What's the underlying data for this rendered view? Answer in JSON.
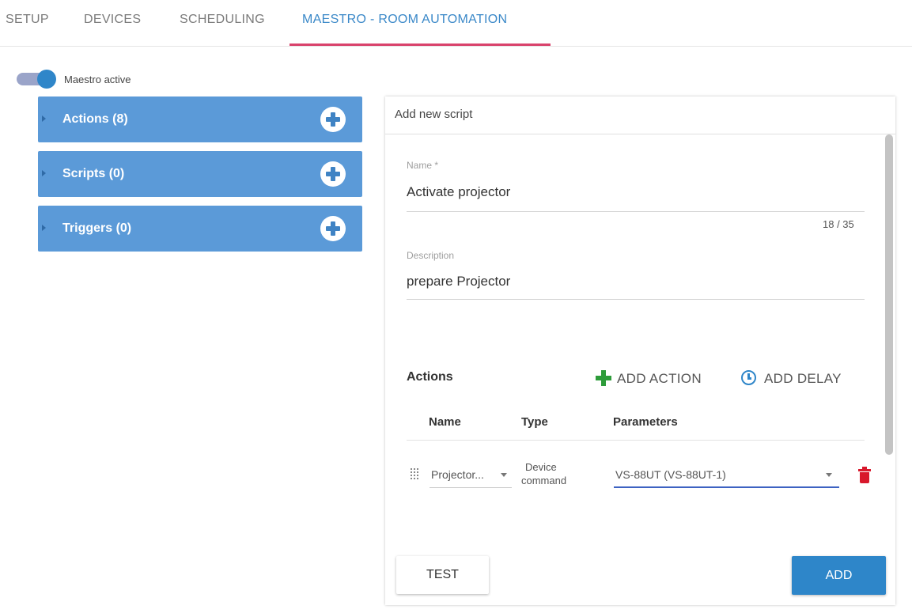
{
  "tabs": [
    {
      "label": "SETUP"
    },
    {
      "label": "DEVICES"
    },
    {
      "label": "SCHEDULING"
    },
    {
      "label": "MAESTRO - ROOM AUTOMATION",
      "active": true
    }
  ],
  "toggle": {
    "label": "Maestro active",
    "on": true
  },
  "panels": [
    {
      "label": "Actions (8)"
    },
    {
      "label": "Scripts (0)"
    },
    {
      "label": "Triggers (0)"
    }
  ],
  "form": {
    "title": "Add new script",
    "name_label": "Name *",
    "name_value": "Activate projector",
    "name_counter": "18 / 35",
    "description_label": "Description",
    "description_value": "prepare Projector",
    "actions_title": "Actions",
    "add_action_label": "ADD ACTION",
    "add_delay_label": "ADD DELAY",
    "columns": {
      "name": "Name",
      "type": "Type",
      "parameters": "Parameters"
    },
    "rows": [
      {
        "name": "Projector...",
        "type_line1": "Device",
        "type_line2": "command",
        "parameter": "VS-88UT (VS-88UT-1)"
      }
    ],
    "test_label": "TEST",
    "add_label": "ADD"
  },
  "colors": {
    "accent": "#2e86c9",
    "panel": "#5b9ad8",
    "tab_active": "#3a88c8",
    "tab_underline": "#d9436c",
    "add_action": "#2e9c3a",
    "delete": "#d8182c"
  },
  "icons": [
    "plus-circle-icon",
    "plus-icon",
    "clock-icon",
    "drag-handle-icon",
    "chevron-down-icon",
    "trash-icon",
    "caret-right-icon"
  ]
}
